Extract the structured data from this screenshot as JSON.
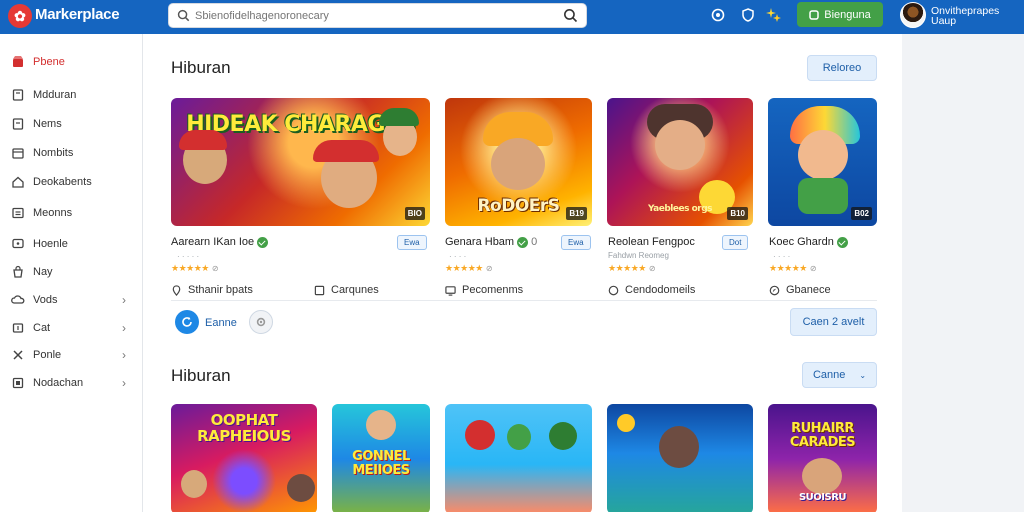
{
  "app": {
    "brand": "Markerplace",
    "logo_glyph": "✿"
  },
  "search": {
    "placeholder": "Sbienofidelhagenoronecary"
  },
  "header": {
    "cta_label": "Bienguna",
    "user_name": "Onvitheprapes Uaup"
  },
  "sidebar": {
    "items": [
      {
        "label": "Pbene",
        "icon": "store-icon",
        "active": true,
        "chevron": false
      },
      {
        "label": "Mdduran",
        "icon": "book-icon",
        "active": false,
        "chevron": false
      },
      {
        "label": "Nems",
        "icon": "document-icon",
        "active": false,
        "chevron": false
      },
      {
        "label": "Nombits",
        "icon": "calendar-icon",
        "active": false,
        "chevron": false
      },
      {
        "label": "Deokabents",
        "icon": "home-icon",
        "active": false,
        "chevron": false
      },
      {
        "label": "Meonns",
        "icon": "list-icon",
        "active": false,
        "chevron": false
      },
      {
        "label": "Hoenle",
        "icon": "chat-icon",
        "active": false,
        "chevron": false
      },
      {
        "label": "Nay",
        "icon": "bag-icon",
        "active": false,
        "chevron": false
      },
      {
        "label": "Vods",
        "icon": "cloud-icon",
        "active": false,
        "chevron": true
      },
      {
        "label": "Cat",
        "icon": "cart-icon",
        "active": false,
        "chevron": true
      },
      {
        "label": "Ponle",
        "icon": "tools-icon",
        "active": false,
        "chevron": true
      },
      {
        "label": "Nodachan",
        "icon": "grid-icon",
        "active": false,
        "chevron": true
      }
    ]
  },
  "section1": {
    "title": "Hiburan",
    "action_label": "Reloreo",
    "cards": [
      {
        "title": "Aarearn IKan Ioe",
        "sub": "· · · · ·",
        "stars": "★★★★★",
        "star_count": "⊘",
        "tag": "Ewa",
        "badge": "BIO",
        "art_text": "HIDEAK CHARAGES",
        "meta_label": "Sthanir bpats",
        "meta_icon": "location-icon"
      },
      {
        "title": "Genara Hbam",
        "title_suffix": "0",
        "sub": "· · · ·",
        "stars": "★★★★★",
        "star_count": "⊘",
        "tag": "Ewa",
        "badge": "B19",
        "art_text": "RoDOErS",
        "meta_label": "Carqunes",
        "meta_icon": "box-icon"
      },
      {
        "title": "Reolean Fengpoc",
        "sub": "Fahdwn Reomeg",
        "stars": "★★★★★",
        "star_count": "⊘",
        "tag": "Dot",
        "badge": "B10",
        "art_text": "Yaeblees orgs",
        "meta_label": "Pecomenms",
        "meta_icon": "screen-icon"
      },
      {
        "title": "Koec Ghardn",
        "sub": "· · · ·",
        "stars": "★★★★★",
        "star_count": "⊘",
        "tag": "",
        "badge": "B02",
        "art_text": "",
        "meta_label": "Cendodomeils",
        "meta_icon": "clock-icon"
      },
      {
        "meta_label": "Gbanece",
        "meta_icon": "compass-icon"
      }
    ],
    "footer_left_label": "Eanne",
    "footer_right_label": "Caen 2 avelt"
  },
  "section2": {
    "title": "Hiburan",
    "action_label": "Canne",
    "cards": [
      {
        "art_text": "OOPHAT RAPHEIOUS"
      },
      {
        "art_text": "GONNEL MEIIOES"
      },
      {
        "art_text": ""
      },
      {
        "art_text": ""
      },
      {
        "art_text": "RUHAIRR CARADES",
        "art_text_2": "SUOISRU"
      }
    ]
  },
  "colors": {
    "topbar": "#1565c0",
    "accent_green": "#43a047",
    "accent_red": "#d32f2f",
    "link_blue": "#1e5fa8"
  }
}
